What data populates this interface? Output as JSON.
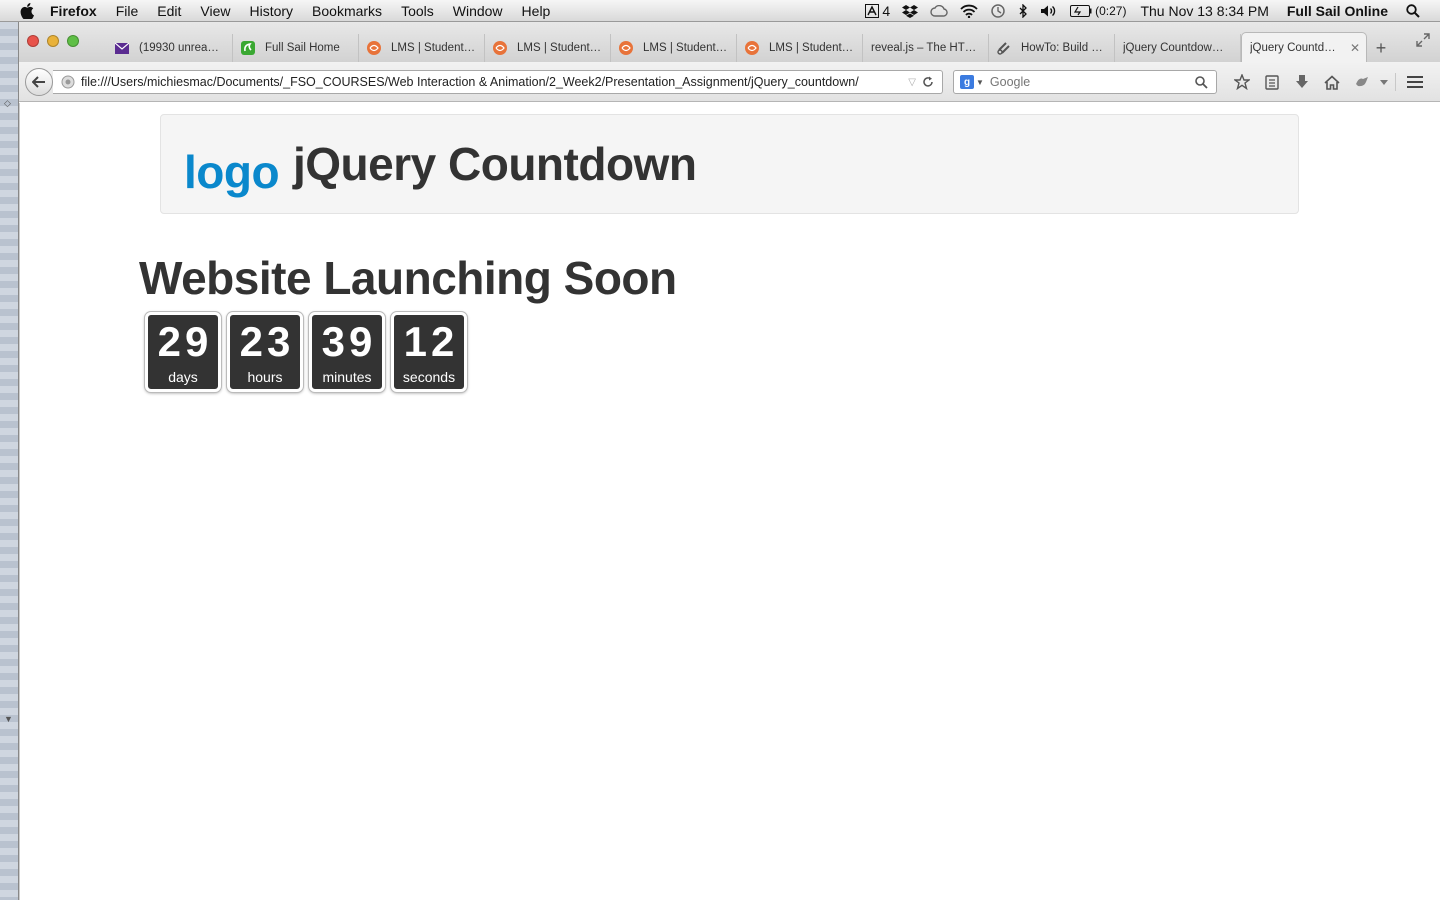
{
  "menubar": {
    "app": "Firefox",
    "items": [
      "File",
      "Edit",
      "View",
      "History",
      "Bookmarks",
      "Tools",
      "Window",
      "Help"
    ],
    "adobe_count": "4",
    "battery": "(0:27)",
    "clock": "Thu Nov 13  8:34 PM",
    "user": "Full Sail Online"
  },
  "tabs": [
    {
      "label": "(19930 unrea…",
      "icon": "mail-icon",
      "color": "#5b2c91"
    },
    {
      "label": "Full Sail Home",
      "icon": "fullsail-icon",
      "color": "#3aa832"
    },
    {
      "label": "LMS | Student…",
      "icon": "lms-icon",
      "color": "#e8733a"
    },
    {
      "label": "LMS | Student…",
      "icon": "lms-icon",
      "color": "#e8733a"
    },
    {
      "label": "LMS | Student…",
      "icon": "lms-icon",
      "color": "#e8733a"
    },
    {
      "label": "LMS | Student…",
      "icon": "lms-icon",
      "color": "#e8733a"
    },
    {
      "label": "reveal.js – The HT…",
      "icon": "",
      "color": ""
    },
    {
      "label": "HowTo: Build …",
      "icon": "link-icon",
      "color": "#555555"
    },
    {
      "label": "jQuery Countdow…",
      "icon": "",
      "color": ""
    },
    {
      "label": "jQuery Countd…",
      "icon": "",
      "color": "",
      "active": true
    }
  ],
  "navbar": {
    "url": "file:///Users/michiesmac/Documents/_FSO_COURSES/Web Interaction & Animation/2_Week2/Presentation_Assignment/jQuery_countdown/",
    "search_placeholder": "Google"
  },
  "page": {
    "logo": "logo",
    "site_title": "jQuery Countdown",
    "heading": "Website Launching Soon",
    "countdown": [
      {
        "value": "29",
        "label": "days"
      },
      {
        "value": "23",
        "label": "hours"
      },
      {
        "value": "39",
        "label": "minutes"
      },
      {
        "value": "12",
        "label": "seconds"
      }
    ]
  },
  "colors": {
    "logo": "#0a88cc",
    "text": "#333333",
    "countdown_bg": "#333333",
    "header_bg": "#f5f5f5"
  }
}
